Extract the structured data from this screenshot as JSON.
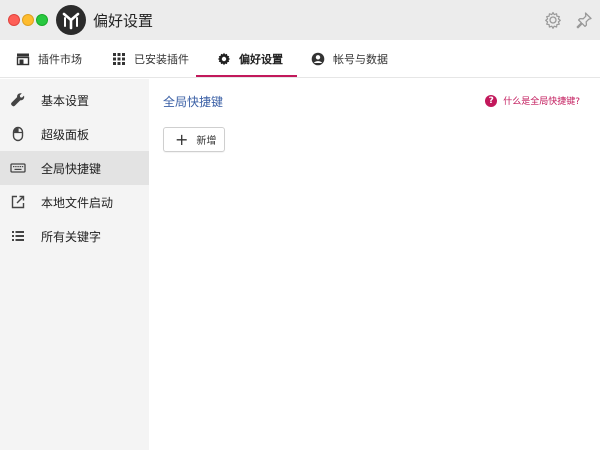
{
  "window": {
    "title": "偏好设置",
    "accent": "#c2185b"
  },
  "tabs": [
    {
      "label": "插件市场",
      "icon": "store-icon"
    },
    {
      "label": "已安装插件",
      "icon": "grid-icon"
    },
    {
      "label": "偏好设置",
      "icon": "gear-icon",
      "active": true
    },
    {
      "label": "帐号与数据",
      "icon": "account-icon"
    }
  ],
  "sidebar": {
    "items": [
      {
        "label": "基本设置",
        "icon": "wrench-icon"
      },
      {
        "label": "超级面板",
        "icon": "mouse-icon"
      },
      {
        "label": "全局快捷键",
        "icon": "keyboard-icon",
        "active": true
      },
      {
        "label": "本地文件启动",
        "icon": "open-external-icon"
      },
      {
        "label": "所有关键字",
        "icon": "list-icon"
      }
    ]
  },
  "main": {
    "section_title": "全局快捷键",
    "help_text": "什么是全局快捷键?",
    "add_button_label": "新增"
  }
}
